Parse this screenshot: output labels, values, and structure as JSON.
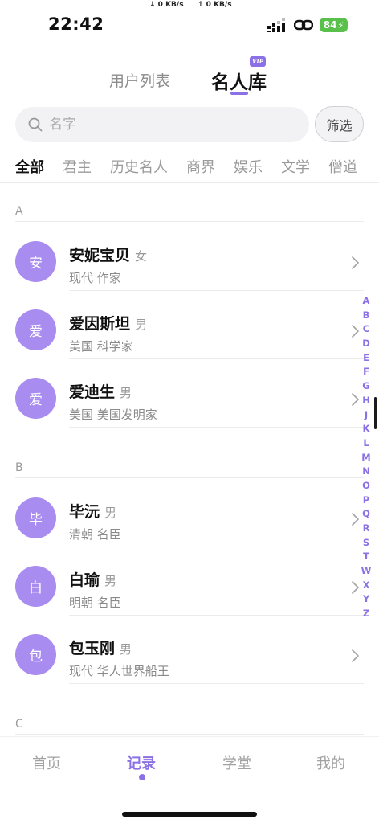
{
  "status_bar": {
    "time": "22:42",
    "net_down": "↓ 0 KB/s",
    "net_up": "↑ 0 KB/s",
    "battery": "84"
  },
  "top_tabs": {
    "users_label": "用户列表",
    "famous_label": "名人库",
    "vip_badge": "VIP",
    "active": "名人库"
  },
  "search": {
    "placeholder": "名字",
    "value": "",
    "filter_label": "筛选"
  },
  "categories": [
    "全部",
    "君主",
    "历史名人",
    "商界",
    "娱乐",
    "文学",
    "僧道"
  ],
  "active_category": "全部",
  "sections": [
    {
      "letter": "A",
      "items": [
        {
          "avatar": "安",
          "name": "安妮宝贝",
          "gender": "女",
          "desc": "现代 作家"
        },
        {
          "avatar": "爱",
          "name": "爱因斯坦",
          "gender": "男",
          "desc": "美国 科学家"
        },
        {
          "avatar": "爱",
          "name": "爱迪生",
          "gender": "男",
          "desc": "美国 美国发明家"
        }
      ]
    },
    {
      "letter": "B",
      "items": [
        {
          "avatar": "毕",
          "name": "毕沅",
          "gender": "男",
          "desc": "清朝 名臣"
        },
        {
          "avatar": "白",
          "name": "白瑜",
          "gender": "男",
          "desc": "明朝 名臣"
        },
        {
          "avatar": "包",
          "name": "包玉刚",
          "gender": "男",
          "desc": "现代 华人世界船王"
        }
      ]
    },
    {
      "letter": "C",
      "items": []
    }
  ],
  "alphabet_index": [
    "A",
    "B",
    "C",
    "D",
    "E",
    "F",
    "G",
    "H",
    "J",
    "K",
    "L",
    "M",
    "N",
    "O",
    "P",
    "Q",
    "R",
    "S",
    "T",
    "W",
    "X",
    "Y",
    "Z"
  ],
  "bottom_nav": {
    "items": [
      "首页",
      "记录",
      "学堂",
      "我的"
    ],
    "active": "记录"
  },
  "colors": {
    "accent": "#8b70e6",
    "avatar_bg": "#a98cf0",
    "battery": "#58c04b"
  }
}
